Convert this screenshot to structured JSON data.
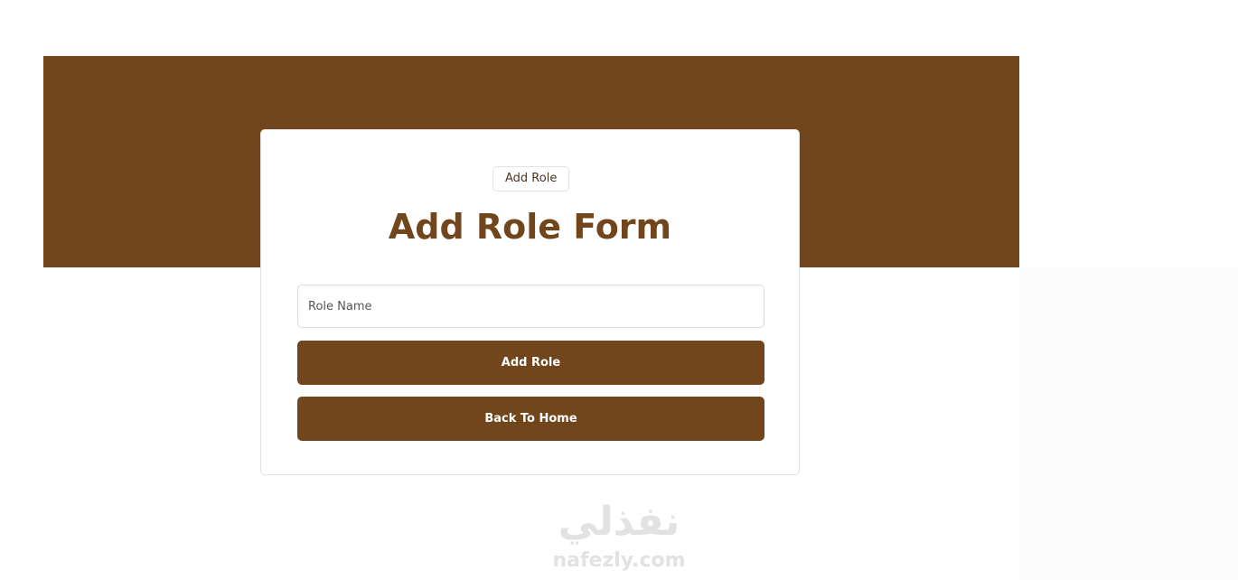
{
  "colors": {
    "brand": "#72461c",
    "background": "#ffffff",
    "card": "#ffffff",
    "watermark": "#e2e2e2"
  },
  "card": {
    "badge": "Add Role",
    "title": "Add Role Form",
    "role_name_field": {
      "placeholder": "Role Name",
      "value": ""
    },
    "add_button_label": "Add Role",
    "back_button_label": "Back To Home"
  },
  "watermark": {
    "arabic_text": "نفذلي",
    "latin_text": "nafezly.com"
  }
}
